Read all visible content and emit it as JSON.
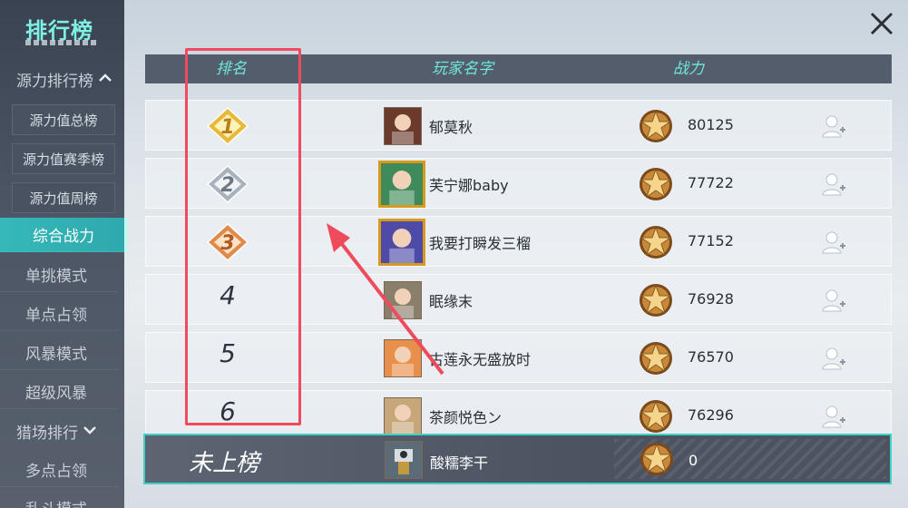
{
  "sidebar": {
    "title": "排行榜",
    "groups": [
      {
        "label": "源力排行榜",
        "chevron": "up"
      },
      {
        "label": "猎场排行",
        "chevron": "down"
      }
    ],
    "subitems": [
      "源力值总榜",
      "源力值赛季榜",
      "源力值周榜"
    ],
    "items": [
      "综合战力",
      "单挑模式",
      "单点占领",
      "风暴模式",
      "超级风暴"
    ],
    "items_after": [
      "多点占领",
      "乱斗模式"
    ],
    "active": "综合战力"
  },
  "close_icon": "close-icon",
  "table": {
    "headers": {
      "rank": "排名",
      "player": "玩家名字",
      "power": "战力"
    },
    "rows": [
      {
        "rank": "1",
        "medal": "gold",
        "name": "郁莫秋",
        "power": "80125",
        "frame": false,
        "avatar_color": "#6b3a2c"
      },
      {
        "rank": "2",
        "medal": "silver",
        "name": "芙宁娜baby",
        "power": "77722",
        "frame": true,
        "avatar_color": "#3f8a5a"
      },
      {
        "rank": "3",
        "medal": "bronze",
        "name": "我要打瞬发三榴",
        "power": "77152",
        "frame": true,
        "avatar_color": "#4e4aa8"
      },
      {
        "rank": "4",
        "medal": "",
        "name": "眠缘末",
        "power": "76928",
        "frame": false,
        "avatar_color": "#8a7f6a"
      },
      {
        "rank": "5",
        "medal": "",
        "name": "古莲永无盛放时",
        "power": "76570",
        "frame": false,
        "avatar_color": "#e8904a"
      },
      {
        "rank": "6",
        "medal": "",
        "name": "茶颜悦色ン",
        "power": "76296",
        "frame": false,
        "avatar_color": "#c7a67a"
      }
    ]
  },
  "my_row": {
    "rank_text": "未上榜",
    "name": "酸糯李干",
    "power": "0",
    "avatar_color": "#5b6b78"
  },
  "colors": {
    "accent": "#3ed1c8",
    "header_text": "#6fe7dc",
    "annotation": "#ee4b5c"
  }
}
